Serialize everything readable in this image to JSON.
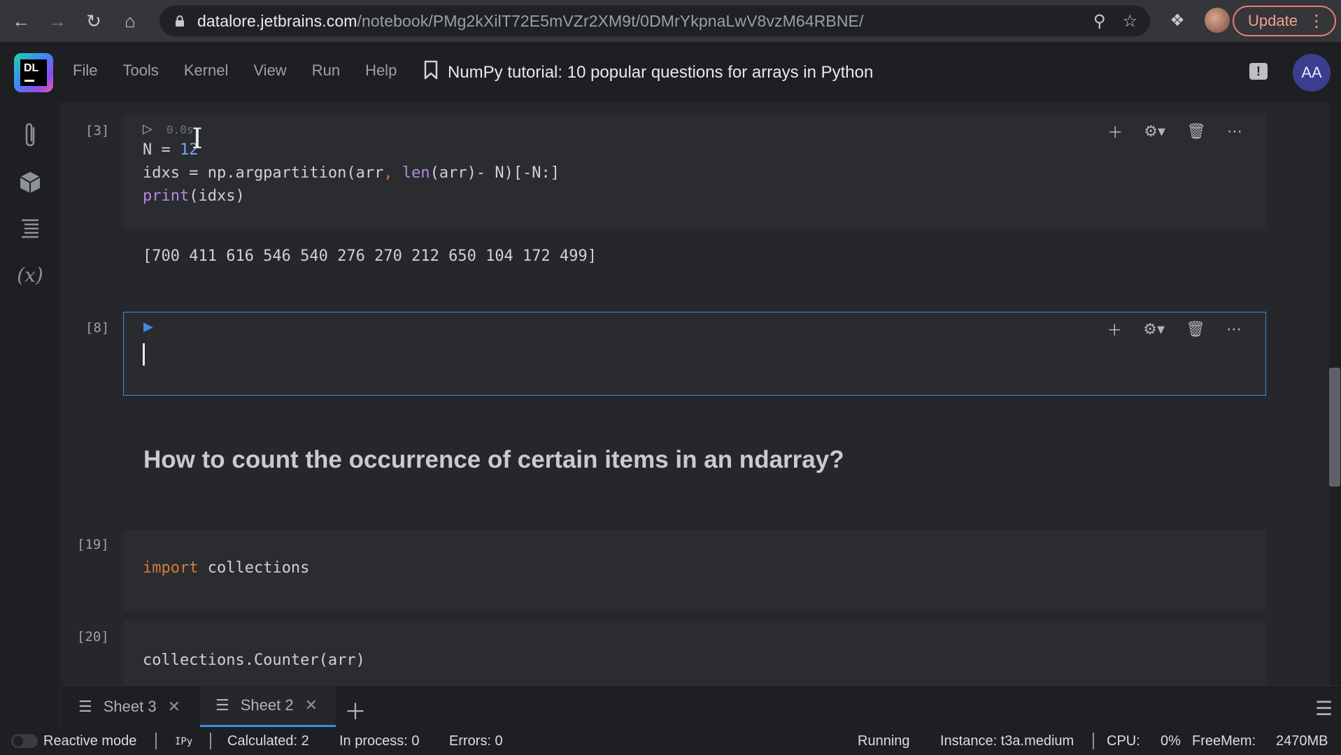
{
  "browser": {
    "url_host": "datalore.jetbrains.com",
    "url_path": "/notebook/PMg2kXilT72E5mVZr2XM9t/0DMrYkpnaLwV8vzM64RBNE/",
    "update_label": "Update"
  },
  "app": {
    "logo_text": "DL",
    "menu": [
      "File",
      "Tools",
      "Kernel",
      "View",
      "Run",
      "Help"
    ],
    "title": "NumPy tutorial: 10 popular questions for arrays in Python",
    "avatar_initials": "AA",
    "feedback_glyph": "!"
  },
  "rail": {
    "variables_label": "(x)"
  },
  "cells": {
    "c3": {
      "exec_count": "[3]",
      "timing": "0.0s",
      "line1_a": "N = ",
      "line1_num": "12",
      "line2_a": "idxs = np.argpartition(arr",
      "line2_comma": ",",
      "line2_fn": " len",
      "line2_b": "(arr)- N)[-N:]",
      "line3_fn": "print",
      "line3_b": "(idxs)",
      "output": "[700 411 616 546 540 276 270 212 650 104 172 499]"
    },
    "c8": {
      "exec_count": "[8]"
    },
    "heading": "How to count the occurrence of certain items in an ndarray?",
    "c19": {
      "exec_count": "[19]",
      "kw": "import",
      "rest": " collections"
    },
    "c20": {
      "exec_count": "[20]",
      "code": "collections.Counter(arr)"
    }
  },
  "sheets": {
    "tabs": [
      {
        "label": "Sheet 3",
        "active": false
      },
      {
        "label": "Sheet 2",
        "active": true
      }
    ]
  },
  "status": {
    "reactive_mode": "Reactive mode",
    "kernel": "IPy",
    "calculated": "Calculated: 2",
    "in_process": "In process: 0",
    "errors": "Errors: 0",
    "running": "Running",
    "instance": "Instance: t3a.medium",
    "cpu_label": "CPU:",
    "cpu_value": "0%",
    "freemem_label": "FreeMem:",
    "freemem_value": "2470MB"
  }
}
